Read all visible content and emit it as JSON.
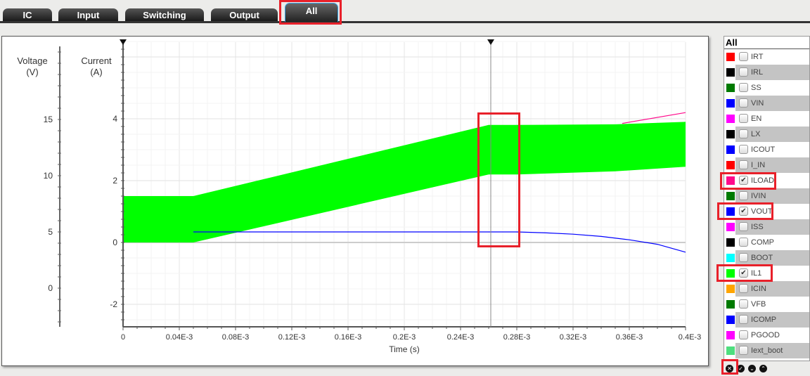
{
  "tabs": [
    {
      "label": "IC"
    },
    {
      "label": "Input"
    },
    {
      "label": "Switching"
    },
    {
      "label": "Output"
    },
    {
      "label": "All",
      "active": true
    }
  ],
  "legend": {
    "title": "All",
    "items": [
      {
        "label": "IRT",
        "color": "#ff0000",
        "checked": false
      },
      {
        "label": "IRL",
        "color": "#000000",
        "checked": false
      },
      {
        "label": "SS",
        "color": "#007a00",
        "checked": false
      },
      {
        "label": "VIN",
        "color": "#0000ff",
        "checked": false
      },
      {
        "label": "EN",
        "color": "#ff00ff",
        "checked": false
      },
      {
        "label": "LX",
        "color": "#000000",
        "checked": false
      },
      {
        "label": "ICOUT",
        "color": "#0000ff",
        "checked": false
      },
      {
        "label": "I_IN",
        "color": "#ff0000",
        "checked": false
      },
      {
        "label": "ILOAD",
        "color": "#ff0a8c",
        "checked": true
      },
      {
        "label": "IVIN",
        "color": "#007a00",
        "checked": false
      },
      {
        "label": "VOUT",
        "color": "#0000ff",
        "checked": true
      },
      {
        "label": "ISS",
        "color": "#ff00ff",
        "checked": false
      },
      {
        "label": "COMP",
        "color": "#000000",
        "checked": false
      },
      {
        "label": "BOOT",
        "color": "#00ffff",
        "checked": false
      },
      {
        "label": "IL1",
        "color": "#00ff00",
        "checked": true
      },
      {
        "label": "ICIN",
        "color": "#ffa500",
        "checked": false
      },
      {
        "label": "VFB",
        "color": "#007a00",
        "checked": false
      },
      {
        "label": "ICOMP",
        "color": "#0000ff",
        "checked": false
      },
      {
        "label": "PGOOD",
        "color": "#ff00ff",
        "checked": false
      },
      {
        "label": "Iext_boot",
        "color": "#4ede7e",
        "checked": false
      }
    ]
  },
  "legend_buttons": [
    {
      "icon": "clear-all-icon"
    },
    {
      "icon": "check-all-icon"
    },
    {
      "icon": "expand-down-icon"
    },
    {
      "icon": "collapse-up-icon"
    }
  ],
  "chart_data": {
    "type": "line",
    "xlabel": "Time (s)",
    "xlim": [
      0,
      0.0004
    ],
    "xticks": [
      "0",
      "0.04E-3",
      "0.08E-3",
      "0.12E-3",
      "0.16E-3",
      "0.2E-3",
      "0.24E-3",
      "0.28E-3",
      "0.32E-3",
      "0.36E-3",
      "0.4E-3"
    ],
    "y_current": {
      "label": "Current",
      "unit": "(A)",
      "lim": [
        -2.75,
        6.5
      ],
      "ticks": [
        "4",
        "2",
        "0",
        "-2"
      ]
    },
    "y_voltage": {
      "label": "Voltage",
      "unit": "(V)",
      "lim": [
        -3.4,
        21.6
      ],
      "ticks": [
        "15",
        "10",
        "5",
        "0"
      ]
    },
    "cursor_x": 0.0002615,
    "series": [
      {
        "name": "IL1",
        "axis": "current",
        "kind": "band",
        "color": "#00ff00",
        "x": [
          0,
          5e-05,
          0.00026,
          0.00028,
          0.00035,
          0.0004
        ],
        "upper": [
          1.5,
          1.5,
          3.8,
          3.8,
          3.82,
          3.9
        ],
        "lower": [
          0,
          0,
          2.2,
          2.2,
          2.3,
          2.45
        ]
      },
      {
        "name": "ILOAD",
        "axis": "current",
        "kind": "line",
        "color": "#ff0a8c",
        "x": [
          0.000355,
          0.0004
        ],
        "y": [
          3.85,
          4.2
        ]
      },
      {
        "name": "VOUT",
        "axis": "voltage",
        "kind": "line",
        "color": "#0000ff",
        "x": [
          5e-05,
          0.00026,
          0.00028,
          0.0003,
          0.00032,
          0.00034,
          0.00036,
          0.00038,
          0.0004
        ],
        "y": [
          5.0,
          5.0,
          5.0,
          4.92,
          4.8,
          4.6,
          4.3,
          3.9,
          3.2
        ]
      }
    ]
  }
}
